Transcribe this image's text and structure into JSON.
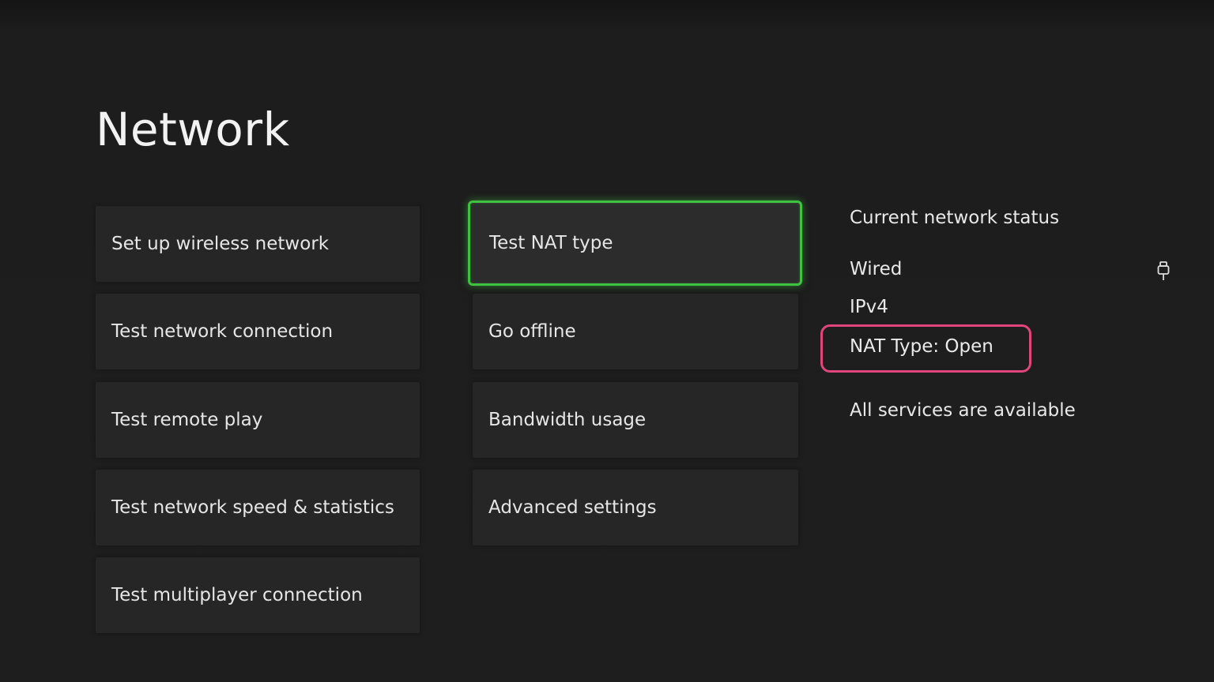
{
  "page": {
    "title": "Network"
  },
  "menu": {
    "left_column": [
      {
        "label": "Set up wireless network"
      },
      {
        "label": "Test network connection"
      },
      {
        "label": "Test remote play"
      },
      {
        "label": "Test network speed & statistics"
      },
      {
        "label": "Test multiplayer connection"
      }
    ],
    "right_column": [
      {
        "label": "Test NAT type",
        "focused": true
      },
      {
        "label": "Go offline"
      },
      {
        "label": "Bandwidth usage"
      },
      {
        "label": "Advanced settings"
      }
    ]
  },
  "status": {
    "heading": "Current network status",
    "connection": "Wired",
    "connection_icon": "ethernet-plug-icon",
    "ip_version": "IPv4",
    "nat_type": "NAT Type: Open",
    "services": "All services are available"
  },
  "colors": {
    "focus": "#3fc23f",
    "highlight": "#e0457b",
    "background": "#1e1e1e",
    "tile": "#262626"
  }
}
